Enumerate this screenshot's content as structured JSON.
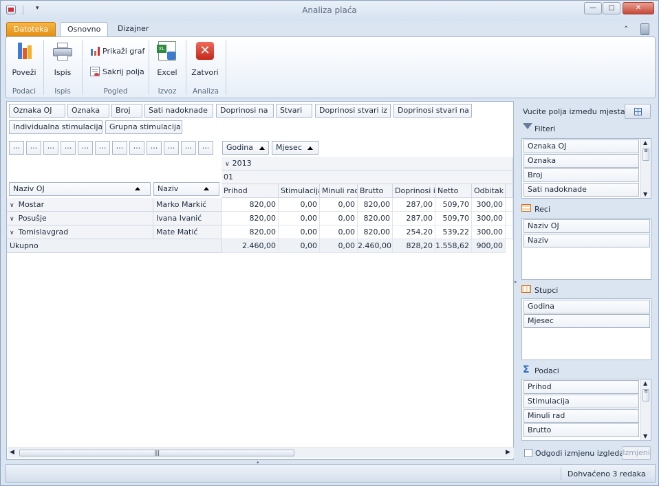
{
  "window": {
    "title": "Analiza plaća",
    "controls": {
      "minimize": "—",
      "maximize": "□",
      "close": "✕"
    }
  },
  "quick_access": {
    "customize": "▾"
  },
  "tabs": {
    "file": "Datoteka",
    "home": "Osnovno",
    "design": "Dizajner"
  },
  "ribbon": {
    "groups": [
      {
        "label": "Podaci",
        "buttons": [
          "Poveži"
        ]
      },
      {
        "label": "Ispis",
        "buttons": [
          "Ispis"
        ]
      },
      {
        "label": "Pogled",
        "buttons": [
          "Prikaži graf",
          "Sakrij polja"
        ]
      },
      {
        "label": "Izvoz",
        "buttons": [
          "Excel"
        ]
      },
      {
        "label": "Analiza",
        "buttons": [
          "Zatvori"
        ]
      }
    ]
  },
  "filter_fields": [
    "Oznaka OJ",
    "Oznaka",
    "Broj",
    "Sati nadoknade",
    "Doprinosi na",
    "Stvari",
    "Doprinosi stvari iz",
    "Doprinosi stvari na",
    "Individualna stimulacija",
    "Grupna stimulacija"
  ],
  "data_field_placeholders": [
    "...",
    "...",
    "...",
    "...",
    "...",
    "...",
    "...",
    "...",
    "...",
    "...",
    "...",
    "..."
  ],
  "column_fields": [
    "Godina",
    "Mjesec"
  ],
  "row_fields": [
    "Naziv OJ",
    "Naziv"
  ],
  "column_values": {
    "year": "2013",
    "month": "01"
  },
  "measures": [
    "Prihod",
    "Stimulacija",
    "Minuli rad",
    "Brutto",
    "Doprinosi iz",
    "Netto",
    "Odbitak"
  ],
  "rows": [
    {
      "oj": "Mostar",
      "name": "Marko Markić",
      "values": [
        "820,00",
        "0,00",
        "0,00",
        "820,00",
        "287,00",
        "509,70",
        "300,00"
      ]
    },
    {
      "oj": "Posušje",
      "name": "Ivana Ivanić",
      "values": [
        "820,00",
        "0,00",
        "0,00",
        "820,00",
        "287,00",
        "509,70",
        "300,00"
      ]
    },
    {
      "oj": "Tomislavgrad",
      "name": "Mate Matić",
      "values": [
        "820,00",
        "0,00",
        "0,00",
        "820,00",
        "254,20",
        "539,22",
        "300,00"
      ]
    }
  ],
  "total": {
    "label": "Ukupno",
    "values": [
      "2.460,00",
      "0,00",
      "0,00",
      "2.460,00",
      "828,20",
      "1.558,62",
      "900,00"
    ]
  },
  "field_list": {
    "hint": "Vucite polja između mjesta...",
    "filters_label": "Filteri",
    "filters": [
      "Oznaka OJ",
      "Oznaka",
      "Broj",
      "Sati nadoknade"
    ],
    "rows_label": "Reci",
    "rows": [
      "Naziv OJ",
      "Naziv"
    ],
    "columns_label": "Stupci",
    "columns": [
      "Godina",
      "Mjesec"
    ],
    "data_label": "Podaci",
    "data": [
      "Prihod",
      "Stimulacija",
      "Minuli rad",
      "Brutto"
    ],
    "defer_label": "Odgodi izmjenu izgleda",
    "update_button": "Izmjeni"
  },
  "status": {
    "text": "Dohvaćeno 3 redaka"
  }
}
